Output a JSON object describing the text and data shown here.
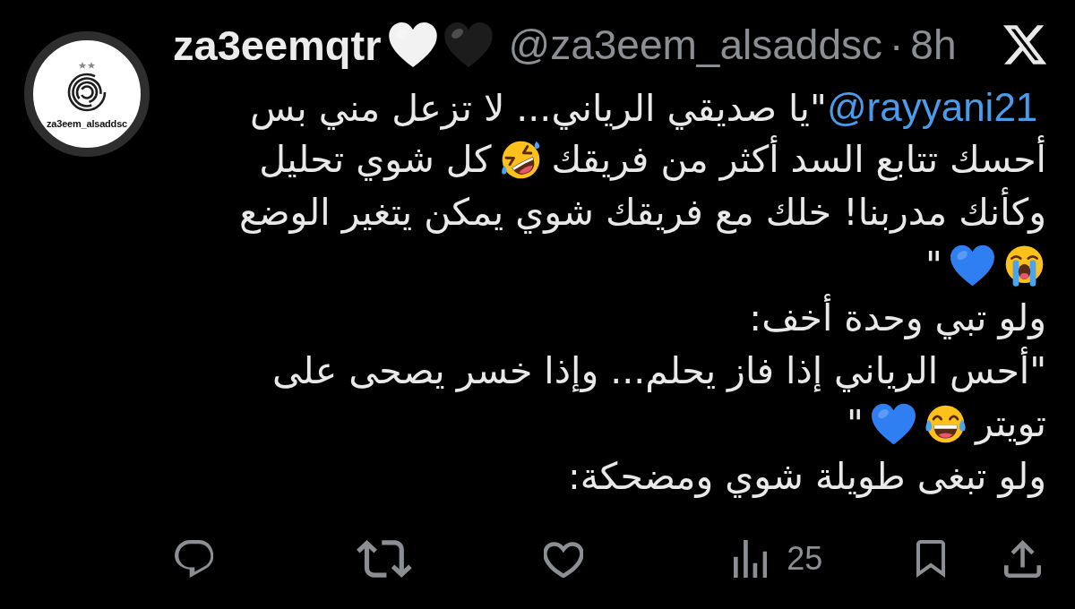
{
  "tweet": {
    "avatar": {
      "caption": "za3eem_alsaddsc"
    },
    "author": {
      "name": "za3eemqtr",
      "name_emoji": [
        {
          "kind": "heart",
          "color": "#f2f2f2"
        },
        {
          "kind": "heart",
          "color": "#1c1c1c"
        }
      ],
      "handle": "@za3eem_alsaddsc",
      "separator": "·",
      "time": "8h"
    },
    "body": [
      {
        "segments": [
          {
            "kind": "mention",
            "text": "@rayyani21"
          },
          {
            "kind": "text",
            "text": "\"يا صديقي الرياني... لا تزعل مني بس"
          }
        ]
      },
      {
        "segments": [
          {
            "kind": "text",
            "text": "أحسك تتابع السد أكثر من فريقك"
          },
          {
            "kind": "rofl"
          },
          {
            "kind": "text",
            "text": "كل شوي تحليل"
          }
        ]
      },
      {
        "segments": [
          {
            "kind": "text",
            "text": "وكأنك مدربنا! خلك مع فريقك شوي يمكن يتغير الوضع"
          }
        ]
      },
      {
        "segments": [
          {
            "kind": "sob"
          },
          {
            "kind": "heart",
            "color": "#2f7ff2"
          },
          {
            "kind": "text",
            "text": "\""
          }
        ]
      },
      {
        "segments": [
          {
            "kind": "text",
            "text": "ولو تبي وحدة أخف:"
          }
        ]
      },
      {
        "segments": [
          {
            "kind": "text",
            "text": "\"أحس الرياني إذا فاز يحلم... وإذا خسر يصحى على"
          }
        ]
      },
      {
        "segments": [
          {
            "kind": "text",
            "text": "تويتر"
          },
          {
            "kind": "joy"
          },
          {
            "kind": "heart",
            "color": "#2f7ff2"
          },
          {
            "kind": "text",
            "text": "\""
          }
        ]
      },
      {
        "segments": [
          {
            "kind": "text",
            "text": "ولو تبغى طويلة شوي ومضحكة:"
          }
        ]
      }
    ],
    "actions": [
      {
        "kind": "reply"
      },
      {
        "kind": "repost"
      },
      {
        "kind": "like"
      },
      {
        "kind": "views",
        "count": "25"
      },
      {
        "kind": "bookmark"
      },
      {
        "kind": "share"
      }
    ]
  }
}
